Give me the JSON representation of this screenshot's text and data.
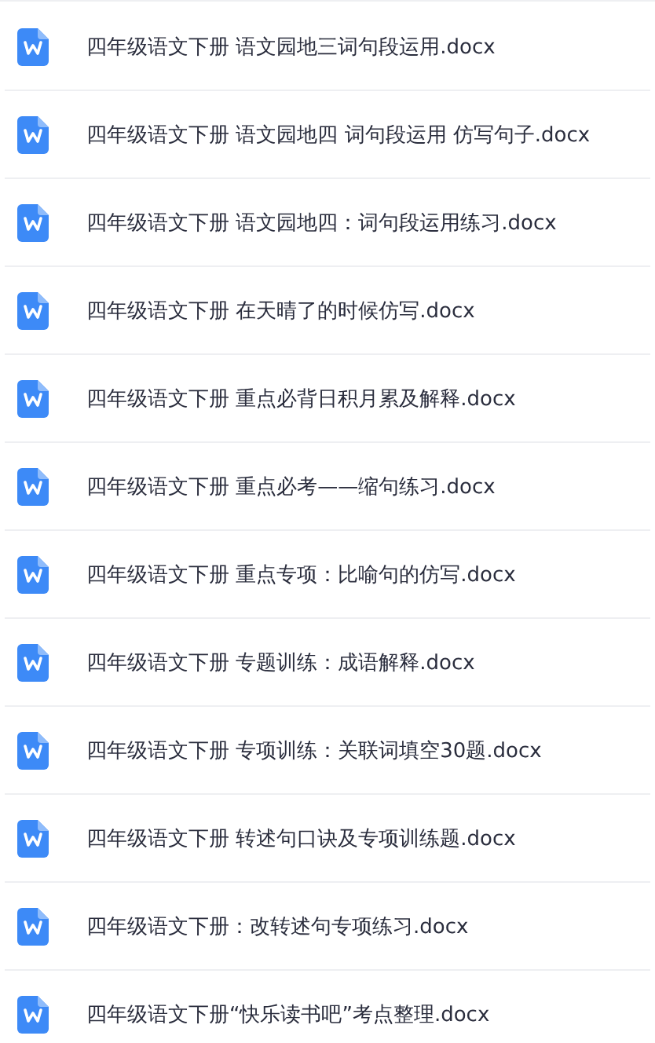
{
  "files": [
    {
      "name": "四年级语文下册 语文园地三词句段运用.docx"
    },
    {
      "name": "四年级语文下册 语文园地四 词句段运用 仿写句子.docx"
    },
    {
      "name": "四年级语文下册 语文园地四：词句段运用练习.docx"
    },
    {
      "name": "四年级语文下册 在天晴了的时候仿写.docx"
    },
    {
      "name": "四年级语文下册 重点必背日积月累及解释.docx"
    },
    {
      "name": "四年级语文下册 重点必考——缩句练习.docx"
    },
    {
      "name": "四年级语文下册 重点专项：比喻句的仿写.docx"
    },
    {
      "name": "四年级语文下册 专题训练：成语解释.docx"
    },
    {
      "name": "四年级语文下册 专项训练：关联词填空30题.docx"
    },
    {
      "name": "四年级语文下册 转述句口诀及专项训练题.docx"
    },
    {
      "name": "四年级语文下册：改转述句专项练习.docx"
    },
    {
      "name": "四年级语文下册“快乐读书吧”考点整理.docx"
    }
  ]
}
